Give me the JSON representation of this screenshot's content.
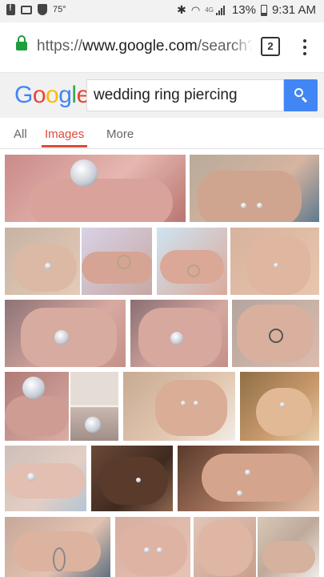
{
  "status_bar": {
    "temperature": "75°",
    "network": "4G",
    "battery": "13%",
    "time": "9:31 AM"
  },
  "browser": {
    "url_scheme": "https://",
    "url_host": "www.google.com",
    "url_path": "/search?",
    "tab_count": "2"
  },
  "search": {
    "logo_letters": [
      "G",
      "o",
      "o",
      "g",
      "l",
      "e"
    ],
    "logo_colors": [
      "#4285f4",
      "#ea4335",
      "#fbbc05",
      "#4285f4",
      "#34a853",
      "#ea4335"
    ],
    "query": "wedding ring piercing"
  },
  "tabs": [
    {
      "label": "All",
      "active": false
    },
    {
      "label": "Images",
      "active": true
    },
    {
      "label": "More",
      "active": false
    }
  ],
  "colors": {
    "accent_tab": "#dd4b39",
    "search_button": "#4285f4",
    "lock": "#1e9e3c"
  }
}
